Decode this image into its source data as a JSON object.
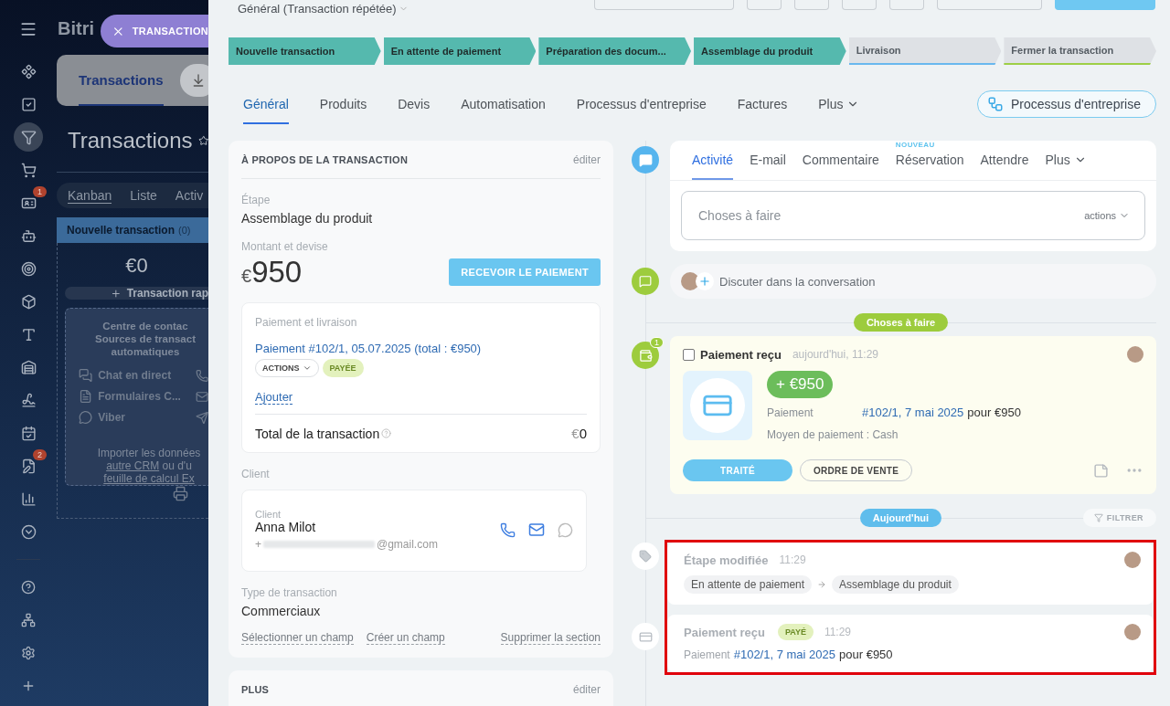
{
  "app": {
    "logo": "Bitri",
    "pill": "TRANSACTION"
  },
  "sidebar": {
    "items": [
      {
        "kind": "collab",
        "selected": false
      },
      {
        "kind": "tasks",
        "selected": false
      },
      {
        "kind": "crm",
        "selected": true
      },
      {
        "kind": "shop",
        "selected": false
      },
      {
        "kind": "contacts",
        "selected": false,
        "badge": "1"
      },
      {
        "kind": "robot",
        "selected": false
      },
      {
        "kind": "target",
        "selected": false
      },
      {
        "kind": "box",
        "selected": false
      },
      {
        "kind": "text",
        "selected": false
      },
      {
        "kind": "bank",
        "selected": false
      },
      {
        "kind": "sign",
        "selected": false
      },
      {
        "kind": "booking",
        "selected": false
      },
      {
        "kind": "docs",
        "selected": false,
        "badge": "2"
      },
      {
        "kind": "stats",
        "selected": false
      },
      {
        "kind": "more",
        "selected": false
      }
    ],
    "bottom_items": [
      {
        "kind": "help"
      },
      {
        "kind": "network"
      },
      {
        "kind": "settings"
      },
      {
        "kind": "add"
      }
    ]
  },
  "background_page": {
    "tab": "Transactions",
    "title": "Transactions",
    "views": [
      {
        "label": "Kanban",
        "selected": true
      },
      {
        "label": "Liste",
        "selected": false
      },
      {
        "label": "Activ",
        "selected": false
      }
    ],
    "column": {
      "title": "Nouvelle transaction",
      "count": "(0)",
      "total": "€0",
      "quick_add": "Transaction rap"
    },
    "empty_lines": [
      "Centre de contac",
      "Sources de transact",
      "automatiques"
    ],
    "sources": [
      {
        "kind": "chat",
        "label": "Chat en direct"
      },
      {
        "kind": "form",
        "label": "Formulaires C..."
      },
      {
        "kind": "viber",
        "label": "Viber"
      }
    ],
    "import": {
      "text": "Importer les données",
      "link_1": "autre CRM",
      "text_2": "ou d'u",
      "link_2": "feuille de calcul Ex"
    }
  },
  "panel": {
    "category": "Général (Transaction répétée)",
    "stages": [
      {
        "label": "Nouvelle transaction",
        "passed": true,
        "color": "#55b9ae"
      },
      {
        "label": "En attente de paiement",
        "passed": true,
        "color": "#55b9ae"
      },
      {
        "label": "Préparation des docum...",
        "passed": true,
        "color": "#55b9ae"
      },
      {
        "label": "Assemblage du produit",
        "passed": true,
        "color": "#55b9ae"
      },
      {
        "label": "Livraison",
        "passed": false,
        "color": "#69b8ee"
      },
      {
        "label": "Fermer la transaction",
        "passed": false,
        "color": "#9dcf45"
      }
    ],
    "tabs": [
      {
        "label": "Général",
        "selected": true
      },
      {
        "label": "Produits",
        "selected": false
      },
      {
        "label": "Devis",
        "selected": false
      },
      {
        "label": "Automatisation",
        "selected": false
      },
      {
        "label": "Processus d'entreprise",
        "selected": false
      },
      {
        "label": "Factures",
        "selected": false
      }
    ],
    "more_tab": "Plus",
    "process_button": "Processus d'entreprise"
  },
  "about": {
    "title": "À PROPOS DE LA TRANSACTION",
    "edit": "éditer",
    "stage_label": "Étape",
    "stage": "Assemblage du produit",
    "amount_label": "Montant et devise",
    "currency": "€",
    "amount": "950",
    "pay_button": "RECEVOIR LE PAIEMENT",
    "payment": {
      "title": "Paiement et livraison",
      "link": "Paiement #102/1, 05.07.2025 (total : €950)",
      "actions": "ACTIONS",
      "status": "PAYÉE",
      "add": "Ajouter",
      "total_label": "Total de la transaction",
      "total_currency": "€",
      "total": "0"
    },
    "client_label": "Client",
    "client": {
      "label": "Client",
      "name": "Anna Milot",
      "phone_prefix": "+",
      "email": "@gmail.com"
    },
    "type_label": "Type de transaction",
    "type": "Commerciaux",
    "links": [
      "Sélectionner un champ",
      "Créer un champ",
      "Supprimer la section"
    ]
  },
  "plus_section": {
    "title": "PLUS",
    "edit": "éditer"
  },
  "composer": {
    "tabs": [
      {
        "label": "Activité",
        "selected": true
      },
      {
        "label": "E-mail",
        "selected": false
      },
      {
        "label": "Commentaire",
        "selected": false
      },
      {
        "label": "Réservation",
        "selected": false,
        "badge": "NOUVEAU"
      },
      {
        "label": "Attendre",
        "selected": false
      }
    ],
    "more": "Plus",
    "placeholder": "Choses à faire",
    "actions": "actions"
  },
  "chat": {
    "text": "Discuter dans la conversation"
  },
  "todo_divider": "Choses à faire",
  "payment_card": {
    "counter": "1",
    "checked": false,
    "title": "Paiement reçu",
    "time": "aujourd'hui, 11:29",
    "amount": "+ €950",
    "label": "Paiement",
    "link": "#102/1, 7 mai 2025",
    "suffix": "pour €950",
    "method": "Moyen de paiement : Cash",
    "done_button": "TRAITÉ",
    "order_button": "ORDRE DE VENTE"
  },
  "today_divider": "Aujourd'hui",
  "filter": "FILTRER",
  "history": [
    {
      "kind": "stage",
      "title": "Étape modifiée",
      "time": "11:29",
      "from": "En attente de paiement",
      "to": "Assemblage du produit"
    },
    {
      "kind": "payment",
      "title": "Paiement reçu",
      "status": "PAYÉ",
      "time": "11:29",
      "label": "Paiement",
      "link": "#102/1, 7 mai 2025",
      "suffix": "pour €950"
    }
  ]
}
